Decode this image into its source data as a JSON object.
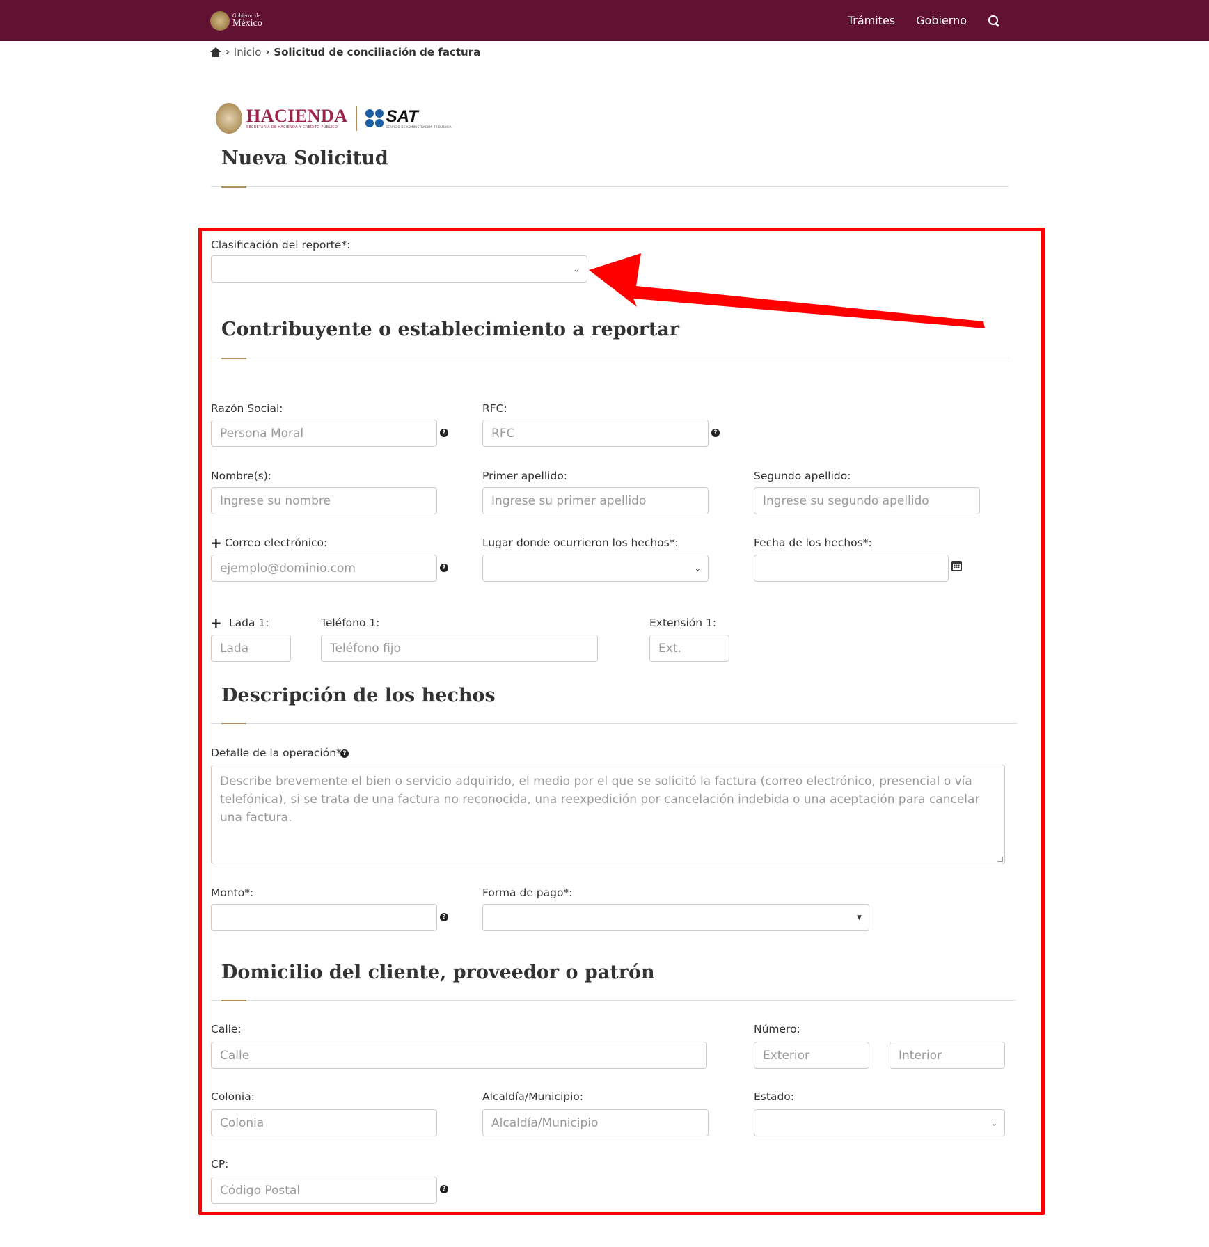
{
  "nav": {
    "logo_small": "Gobierno de",
    "logo_big": "México",
    "links": [
      "Trámites",
      "Gobierno"
    ]
  },
  "breadcrumb": {
    "home": "Inicio",
    "current": "Solicitud de conciliación de factura"
  },
  "agency_logo": {
    "hacienda": "HACIENDA",
    "hacienda_sub": "SECRETARÍA DE HACIENDA Y CRÉDITO PÚBLICO",
    "sat": "SAT",
    "sat_sub": "SERVICIO DE ADMINISTRACIÓN TRIBUTARIA"
  },
  "page_title": "Nueva Solicitud",
  "form": {
    "clasificacion_label": "Clasificación del reporte*:",
    "clasificacion_value": "",
    "section1_title": "Contribuyente o establecimiento a reportar",
    "razon_social_label": "Razón Social:",
    "razon_social_placeholder": "Persona Moral",
    "rfc_label": "RFC:",
    "rfc_placeholder": "RFC",
    "nombre_label": "Nombre(s):",
    "nombre_placeholder": "Ingrese su nombre",
    "primer_apellido_label": "Primer apellido:",
    "primer_apellido_placeholder": "Ingrese su primer apellido",
    "segundo_apellido_label": "Segundo apellido:",
    "segundo_apellido_placeholder": "Ingrese su segundo apellido",
    "correo_label": "Correo electrónico:",
    "correo_placeholder": "ejemplo@dominio.com",
    "lugar_label": "Lugar donde ocurrieron los hechos*:",
    "lugar_value": "",
    "fecha_label": "Fecha de los hechos*:",
    "fecha_value": "",
    "lada_label": "Lada 1:",
    "lada_placeholder": "Lada",
    "telefono_label": "Teléfono 1:",
    "telefono_placeholder": "Teléfono fijo",
    "extension_label": "Extensión 1:",
    "extension_placeholder": "Ext.",
    "section2_title": "Descripción de los hechos",
    "detalle_label": "Detalle de la operación*",
    "detalle_placeholder": "Describe brevemente el bien o servicio adquirido, el medio por el que se solicitó la factura (correo electrónico, presencial o vía telefónica), si se trata de una factura no reconocida, una reexpedición por cancelación indebida o una aceptación para cancelar una factura.",
    "monto_label": "Monto*:",
    "monto_value": "",
    "forma_pago_label": "Forma de pago*:",
    "forma_pago_value": "",
    "section3_title": "Domicilio del cliente, proveedor o patrón",
    "calle_label": "Calle:",
    "calle_placeholder": "Calle",
    "numero_label": "Número:",
    "exterior_placeholder": "Exterior",
    "interior_placeholder": "Interior",
    "colonia_label": "Colonia:",
    "colonia_placeholder": "Colonia",
    "alcaldia_label": "Alcaldía/Municipio:",
    "alcaldia_placeholder": "Alcaldía/Municipio",
    "estado_label": "Estado:",
    "estado_value": "",
    "cp_label": "CP:",
    "cp_placeholder": "Código Postal"
  },
  "colors": {
    "navbar": "#611232",
    "accent": "#b38e5d",
    "annotation": "#ff0000"
  }
}
